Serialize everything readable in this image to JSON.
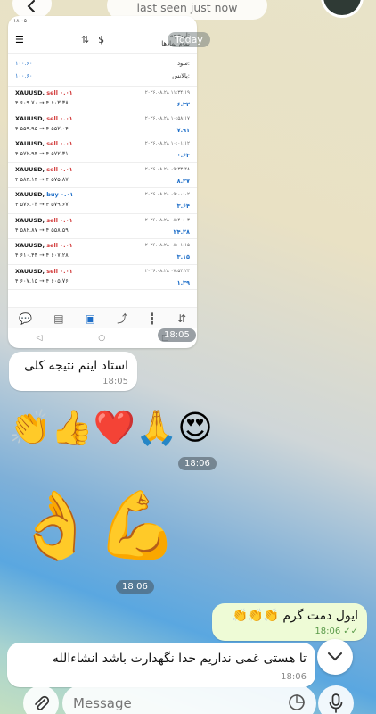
{
  "header": {
    "status": "last seen just now"
  },
  "today_label": "Today",
  "screenshot": {
    "status_left": "۱۸:۰۵",
    "title_line1": "تاریخچه",
    "title_line2": "تمام نمادها",
    "profit_label": "سود:",
    "profit_value": "۱۰۰.۶۰",
    "balance_label": "بالانس:",
    "balance_value": "۱۰۰.۶۰",
    "trades": [
      {
        "symbol": "XAUUSD,",
        "side": "sell",
        "vol": "۰.۰۱",
        "prices": "۴ ۶۰۹.۷۰ → ۴ ۶۰۳.۳۸",
        "date": "۲۰۲۶.۰۸.۲۸ ۱۱:۳۴:۱۹",
        "profit": "۶.۳۲",
        "side_color": "#d23a3a"
      },
      {
        "symbol": "XAUUSD,",
        "side": "sell",
        "vol": "۰.۰۱",
        "prices": "۴ ۵۵۹.۹۵ → ۴ ۵۵۲.۰۴",
        "date": "۲۰۲۶.۰۸.۲۸ ۱۰:۵۸:۱۷",
        "profit": "۷.۹۱",
        "side_color": "#d23a3a"
      },
      {
        "symbol": "XAUUSD,",
        "side": "sell",
        "vol": "۰.۰۱",
        "prices": "۴ ۵۷۲.۹۴ → ۴ ۵۷۲.۳۱",
        "date": "۲۰۲۶.۰۸.۲۸ ۱۰:۰۱:۱۲",
        "profit": "۰.۶۳",
        "side_color": "#d23a3a"
      },
      {
        "symbol": "XAUUSD,",
        "side": "sell",
        "vol": "۰.۰۱",
        "prices": "۴ ۵۸۴.۱۴ → ۴ ۵۷۵.۸۷",
        "date": "۲۰۲۶.۰۸.۲۸ ۰۹:۳۳:۴۸",
        "profit": "۸.۲۷",
        "side_color": "#d23a3a"
      },
      {
        "symbol": "XAUUSD,",
        "side": "buy",
        "vol": "۰.۰۱",
        "prices": "۴ ۵۷۶.۰۳ → ۴ ۵۷۹.۶۷",
        "date": "۲۰۲۶.۰۸.۲۸ ۰۹:۰۰:۰۲",
        "profit": "۳.۶۴",
        "side_color": "#1e6ec8"
      },
      {
        "symbol": "XAUUSD,",
        "side": "sell",
        "vol": "۰.۰۱",
        "prices": "۴ ۵۸۲.۸۷ → ۴ ۵۵۸.۵۹",
        "date": "۲۰۲۶.۰۸.۲۸ ۰۸:۴۰:۰۳",
        "profit": "۲۴.۲۸",
        "side_color": "#d23a3a"
      },
      {
        "symbol": "XAUUSD,",
        "side": "sell",
        "vol": "۰.۰۱",
        "prices": "۴ ۶۱۰.۴۳ → ۴ ۶۰۷.۲۸",
        "date": "۲۰۲۶.۰۸.۲۸ ۰۸:۰۱:۱۵",
        "profit": "۳.۱۵",
        "side_color": "#d23a3a"
      },
      {
        "symbol": "XAUUSD,",
        "side": "sell",
        "vol": "۰.۰۱",
        "prices": "۴ ۶۰۷.۱۵ → ۴ ۶۰۵.۷۶",
        "date": "۲۰۲۶.۰۸.۲۸ ۰۷:۵۴:۲۳",
        "profit": "۱.۳۹",
        "side_color": "#d23a3a"
      }
    ],
    "time": "18:05"
  },
  "messages": {
    "msg1_text": "استاد اینم نتیجه کلی",
    "msg1_time": "18:05",
    "emoji_row1": "👏👍❤️🙏😍",
    "emoji_row1_time": "18:06",
    "emoji_row2": "👌💪",
    "emoji_row2_time": "18:06",
    "out_text": "ایول دمت گرم 👏👏👏",
    "out_time": "18:06",
    "last_text": "تا هستی غمی نداریم خدا نگهدارت باشد انشاءالله",
    "last_time": "18:06"
  },
  "input": {
    "placeholder": "Message"
  }
}
